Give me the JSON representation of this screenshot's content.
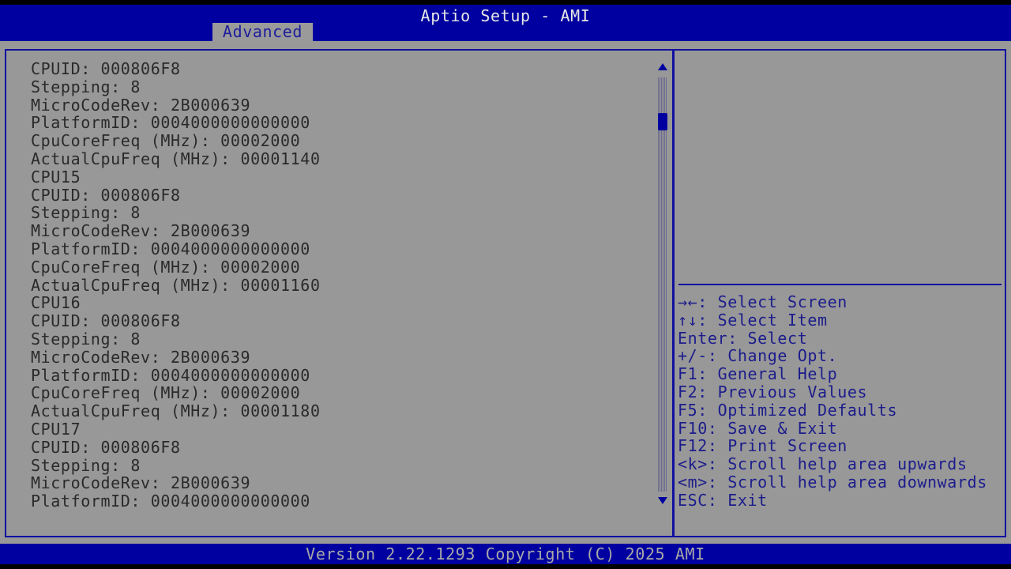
{
  "header": {
    "title": "Aptio Setup - AMI",
    "tab": "Advanced"
  },
  "left_lines": [
    "CPUID: 000806F8",
    "Stepping: 8",
    "MicroCodeRev: 2B000639",
    "PlatformID: 0004000000000000",
    "CpuCoreFreq (MHz): 00002000",
    "ActualCpuFreq (MHz): 00001140",
    "CPU15",
    "CPUID: 000806F8",
    "Stepping: 8",
    "MicroCodeRev: 2B000639",
    "PlatformID: 0004000000000000",
    "CpuCoreFreq (MHz): 00002000",
    "ActualCpuFreq (MHz): 00001160",
    "CPU16",
    "CPUID: 000806F8",
    "Stepping: 8",
    "MicroCodeRev: 2B000639",
    "PlatformID: 0004000000000000",
    "CpuCoreFreq (MHz): 00002000",
    "ActualCpuFreq (MHz): 00001180",
    "CPU17",
    "CPUID: 000806F8",
    "Stepping: 8",
    "MicroCodeRev: 2B000639",
    "PlatformID: 0004000000000000"
  ],
  "help": [
    "→←: Select Screen",
    "↑↓: Select Item",
    "Enter: Select",
    "+/-: Change Opt.",
    "F1: General Help",
    "F2: Previous Values",
    "F5: Optimized Defaults",
    "F10: Save & Exit",
    "F12: Print Screen",
    "<k>: Scroll help area upwards",
    "<m>: Scroll help area downwards",
    "ESC: Exit"
  ],
  "scroll_position": 0.1,
  "footer": "Version 2.22.1293 Copyright (C) 2025 AMI"
}
